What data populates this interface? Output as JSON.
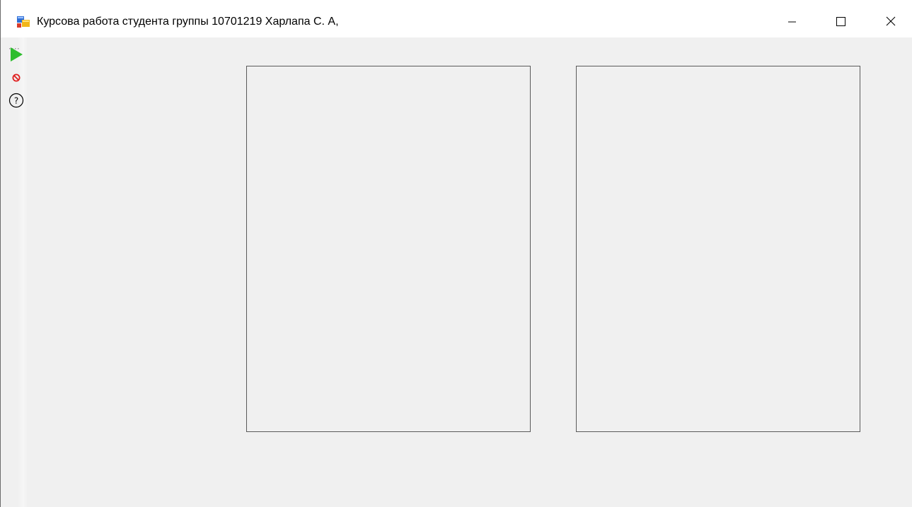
{
  "window": {
    "title": "Курсова работа студента группы 10701219 Харлапа С. А,"
  },
  "title_buttons": {
    "minimize": "minimize-icon",
    "maximize": "maximize-icon",
    "close": "close-icon"
  },
  "toolbar": {
    "items": [
      {
        "name": "start-button",
        "icon": "play-icon",
        "color": "#2ebd2e"
      },
      {
        "name": "stop-button",
        "icon": "stop-icon",
        "color": "#e01e1e"
      },
      {
        "name": "help-button",
        "icon": "help-icon",
        "color": "#000000"
      }
    ]
  },
  "colors": {
    "client_background": "#f0f0f0",
    "panel_border": "#5a5a5a",
    "play_green": "#2ebd2e",
    "stop_red": "#e01e1e"
  }
}
